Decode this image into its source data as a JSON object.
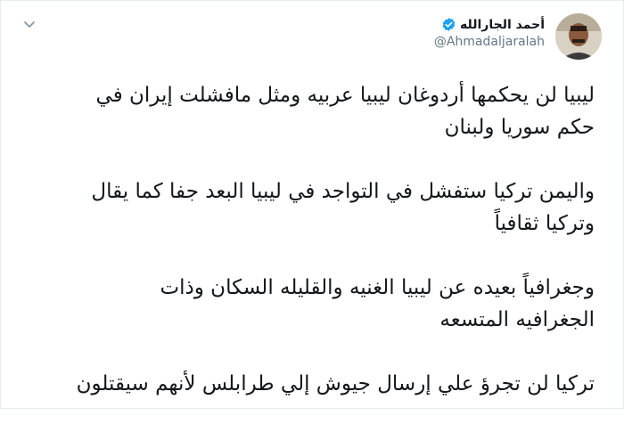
{
  "author": {
    "display_name": "أحمد الجارالله",
    "handle": "@Ahmadaljaralah",
    "verified": true
  },
  "icons": {
    "verified": "verified-badge-icon",
    "menu": "chevron-down-icon"
  },
  "colors": {
    "verified_blue": "#1da1f2",
    "handle_gray": "#657786",
    "text": "#14171a"
  },
  "tweet": {
    "paragraphs": [
      "ليبيا لن يحكمها أردوغان ليبيا عربيه ومثل مافشلت إيران في\nحكم سوريا ولبنان",
      "واليمن تركيا ستفشل في التواجد في ليبيا  البعد جفا كما يقال\nوتركيا ثقافياً",
      "وجغرافياً بعيده عن ليبيا الغنيه والقليله السكان وذات\nالجغرافيه المتسعه",
      "تركيا لن تجرؤ علي إرسال جيوش إلي طرابلس لأنهم سيقتلون"
    ]
  }
}
